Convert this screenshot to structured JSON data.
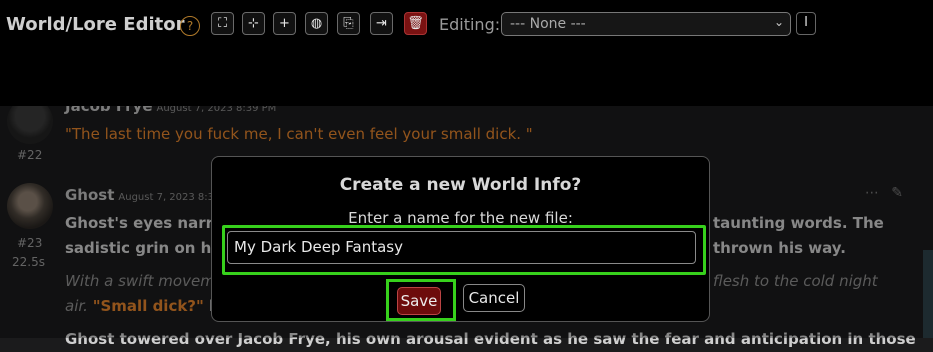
{
  "header": {
    "title": "World/Lore Editor",
    "help_glyph": "?",
    "editing_label": "Editing:",
    "selected_world": "--- None ---",
    "toolbar_icons": [
      "expand-icon",
      "collapse-icon",
      "add-icon",
      "globe-icon",
      "import-icon",
      "export-icon",
      "delete-icon"
    ]
  },
  "messages": [
    {
      "number": "#22",
      "author": "Jacob Frye",
      "date": "August 7, 2023 8:39 PM",
      "text": "\"The last time you fuck me, I can't even feel your small dick. \""
    },
    {
      "number": "#23",
      "time": "22.5s",
      "author": "Ghost",
      "date": "August 7, 2023 8:3",
      "line1": "Ghost's eyes narro",
      "line1_right": "taunting words. The",
      "line2": "sadistic grin on his",
      "line2_right": "thrown his way.",
      "line3": "With a swift moveme",
      "line3_right": "flesh to the cold night",
      "line4_pre": "air. ",
      "line4_quote": "\"Small dick?\"",
      "line4_post": " he",
      "line5": "Ghost towered over Jacob Frye, his own arousal evident as he saw the fear and anticipation in those"
    }
  ],
  "dialog": {
    "title": "Create a new World Info?",
    "prompt": "Enter a name for the new file:",
    "input_value": "My Dark Deep Fantasy",
    "save_label": "Save",
    "cancel_label": "Cancel"
  }
}
